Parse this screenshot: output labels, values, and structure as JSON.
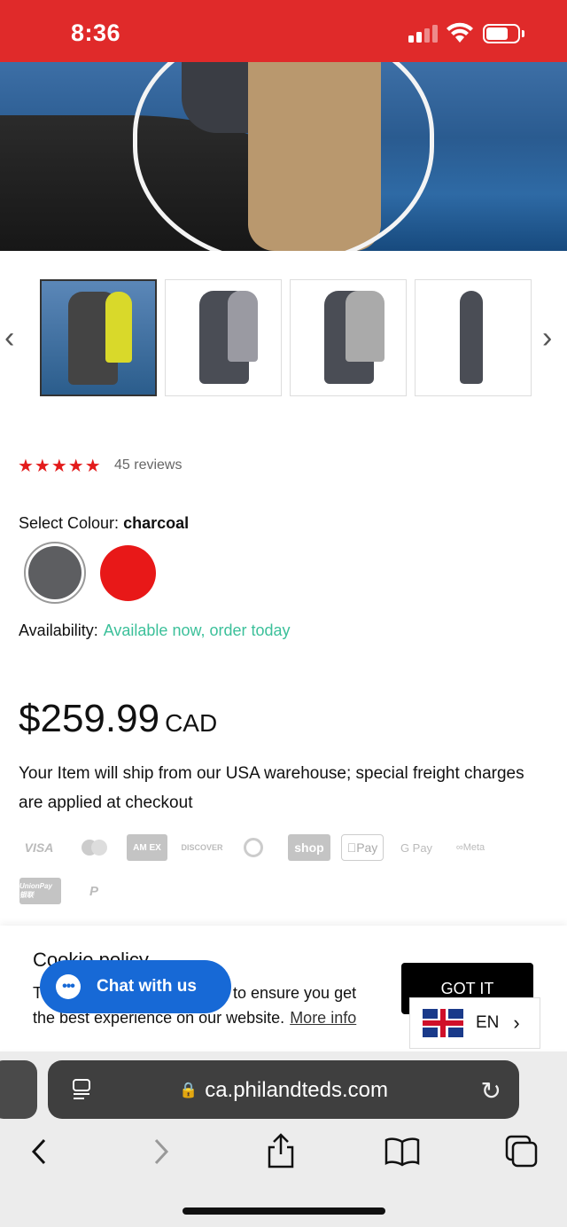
{
  "status_bar": {
    "time": "8:36",
    "battery_level": 0.6
  },
  "gallery": {
    "prev_icon": "chevron-left-icon",
    "next_icon": "chevron-right-icon"
  },
  "rating": {
    "stars": 5,
    "reviews": "45 reviews"
  },
  "colour": {
    "label": "Select Colour:",
    "selected": "charcoal",
    "options": [
      "charcoal",
      "red"
    ],
    "charcoal_hex": "#5d5e61",
    "red_hex": "#e81818"
  },
  "availability": {
    "label": "Availability:",
    "value": "Available now, order today"
  },
  "price": {
    "amount": "$259.99",
    "currency": "CAD"
  },
  "shipping_note": "Your Item will ship from our USA warehouse; special freight charges are applied at checkout",
  "payments": [
    "VISA",
    "Mastercard",
    "AMEX",
    "DISCOVER",
    "Diners",
    "shop",
    "Pay",
    "G Pay",
    "Meta",
    "UnionPay",
    "PayPal"
  ],
  "payment_labels": {
    "visa": "VISA",
    "amex": "AM EX",
    "discover": "DISCOVER",
    "shop": "shop",
    "applepay": "Pay",
    "gpay": "G Pay",
    "meta": "Meta",
    "unionpay": "UnionPay 银联",
    "paypal": "P"
  },
  "cookie": {
    "title": "Cookie policy",
    "text_visible": "to ensure you get the best experience on our website.",
    "text_line1_start": "T",
    "text_line1_end": "to ensure you get",
    "text_line2": "the best experience on our website.",
    "more_info": "More info",
    "accept": "GOT IT"
  },
  "chat": {
    "label": "Chat with us"
  },
  "language": {
    "code": "EN"
  },
  "browser": {
    "url": "ca.philandteds.com"
  },
  "colors": {
    "brand_red": "#e02a2a",
    "accent_green": "#3cc09a",
    "chat_blue": "#1769d6"
  }
}
